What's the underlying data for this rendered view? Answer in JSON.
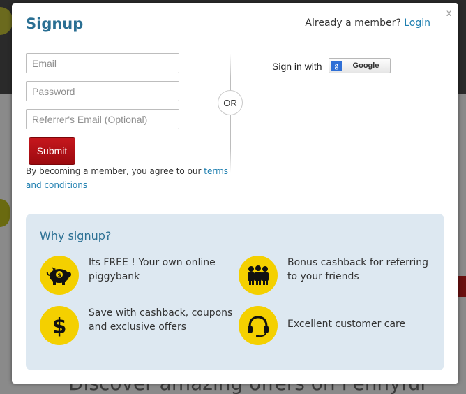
{
  "modal": {
    "title": "Signup",
    "close_label": "x",
    "member_prompt": "Already a member?",
    "login_link": "Login"
  },
  "form": {
    "email_placeholder": "Email",
    "password_placeholder": "Password",
    "referrer_placeholder": "Referrer's Email (Optional)",
    "submit_label": "Submit",
    "terms_prefix": "By becoming a member, you agree to our",
    "terms_link": "terms and conditions"
  },
  "divider": {
    "or_label": "OR"
  },
  "social": {
    "sign_in_with": "Sign in with",
    "google_label": "Google",
    "google_badge": "g"
  },
  "why": {
    "title": "Why signup?",
    "benefits": [
      {
        "icon": "piggybank-icon",
        "text": "Its FREE ! Your own online piggybank"
      },
      {
        "icon": "people-icon",
        "text": "Bonus cashback for referring to your friends"
      },
      {
        "icon": "dollar-icon",
        "text": "Save with cashback, coupons and exclusive offers"
      },
      {
        "icon": "headset-icon",
        "text": "Excellent customer care"
      }
    ]
  },
  "background": {
    "bottom_text": "Discover amazing offers on Pennyful"
  },
  "colors": {
    "accent_blue": "#2a6f93",
    "link_blue": "#1f7fb0",
    "submit_red": "#b3131a",
    "icon_yellow": "#f4d000",
    "why_bg": "#dde8f1"
  }
}
